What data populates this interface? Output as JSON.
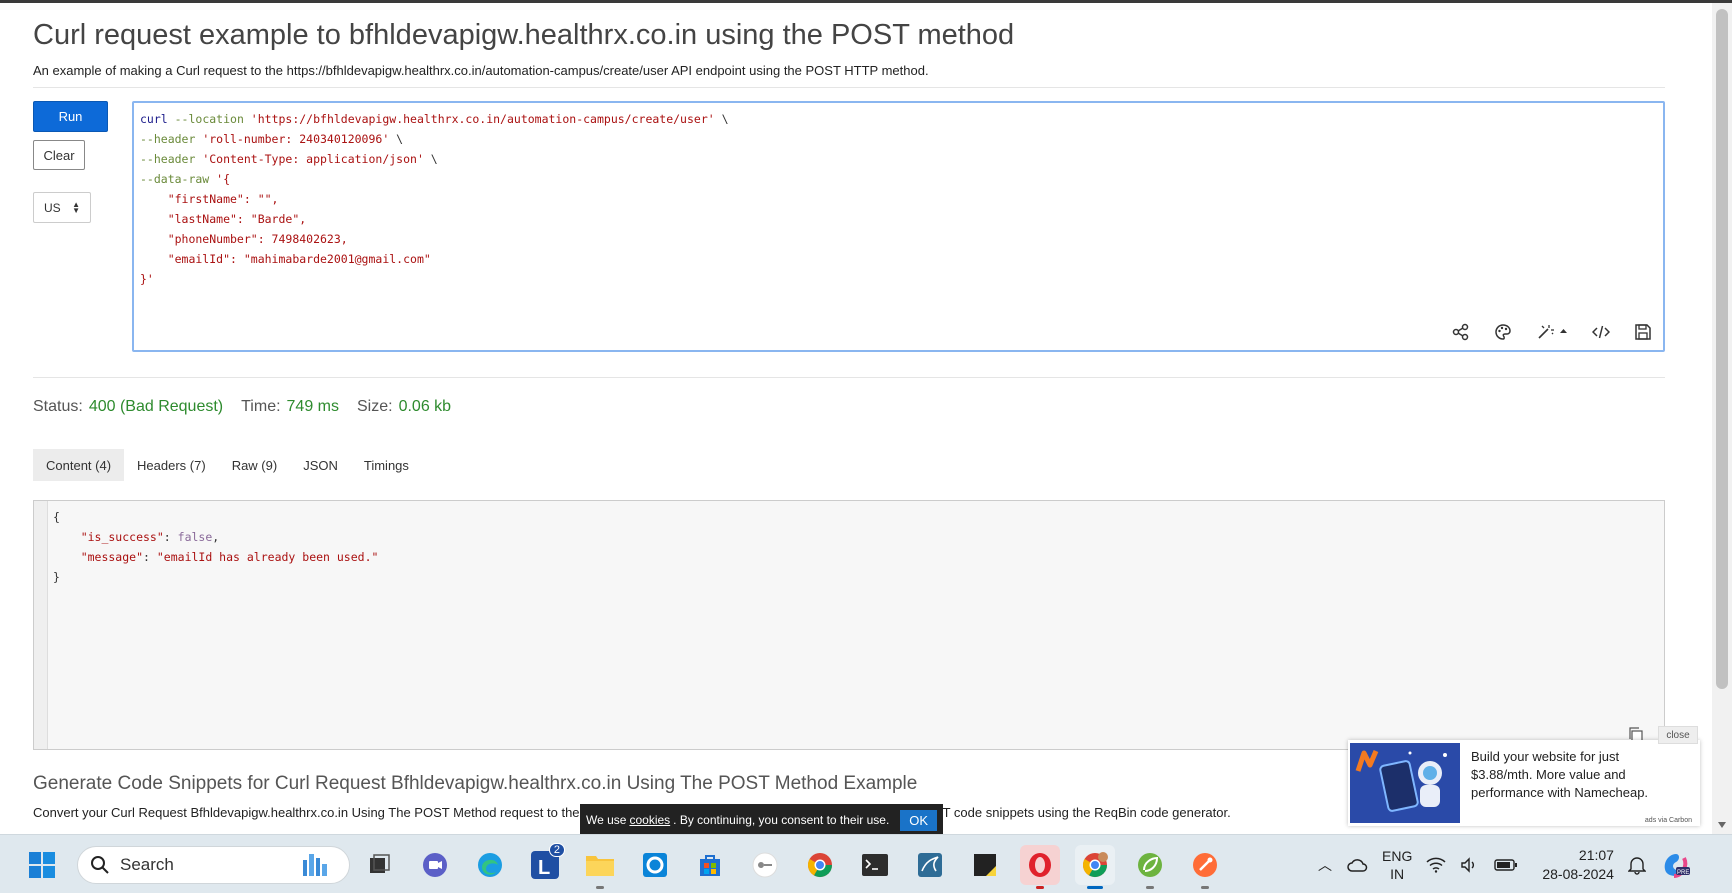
{
  "page": {
    "title": "Curl request example to bfhldevapigw.healthrx.co.in using the POST method",
    "subtitle": "An example of making a Curl request to the https://bfhldevapigw.healthrx.co.in/automation-campus/create/user API endpoint using the POST HTTP method."
  },
  "controls": {
    "run_label": "Run",
    "clear_label": "Clear",
    "region_value": "US"
  },
  "request_code": {
    "line1_cmd": "curl",
    "line1_flag": " --location ",
    "line1_str": "'https://bfhldevapigw.healthrx.co.in/automation-campus/create/user'",
    "line1_end": " \\",
    "line2_flag": "--header ",
    "line2_str": "'roll-number: 240340120096'",
    "line2_end": " \\",
    "line3_flag": "--header ",
    "line3_str": "'Content-Type: application/json'",
    "line3_end": " \\",
    "line4_flag": "--data-raw ",
    "line4_str": "'{",
    "line5": "    \"firstName\": \"\",",
    "line6": "    \"lastName\": \"Barde\",",
    "line7": "    \"phoneNumber\": 7498402623,",
    "line8": "    \"emailId\": \"mahimabarde2001@gmail.com\"",
    "line9": "}'"
  },
  "editor_tools": [
    "share-icon",
    "palette-icon",
    "magic-wand-icon",
    "code-icon",
    "save-icon"
  ],
  "status": {
    "status_label": "Status:",
    "status_value": "400 (Bad Request)",
    "time_label": "Time:",
    "time_value": "749 ms",
    "size_label": "Size:",
    "size_value": "0.06 kb"
  },
  "tabs": [
    {
      "label": "Content (4)"
    },
    {
      "label": "Headers (7)"
    },
    {
      "label": "Raw (9)"
    },
    {
      "label": "JSON"
    },
    {
      "label": "Timings"
    }
  ],
  "response": {
    "line1": "{",
    "line2_key": "    \"is_success\"",
    "line2_sep": ": ",
    "line2_val": "false",
    "line2_end": ",",
    "line3_key": "    \"message\"",
    "line3_sep": ": ",
    "line3_val": "\"emailId has already been used.\"",
    "line4": "}"
  },
  "section": {
    "heading": "Generate Code Snippets for Curl Request Bfhldevapigw.healthrx.co.in Using The POST Method Example",
    "para_start": "Convert your Curl Request Bfhldevapigw.healthrx.co.in Using The POST Method request to the",
    "para_end": "NET code snippets using the ReqBin code generator."
  },
  "cookie": {
    "text_before": "We use",
    "link": "cookies",
    "text_after": ". By continuing, you consent to their use.",
    "ok_label": "OK"
  },
  "ad": {
    "text": "Build your website for just $3.88/mth. More value and performance with Namecheap.",
    "via": "ads via Carbon",
    "close_label": "close"
  },
  "taskbar": {
    "search_placeholder": "Search",
    "lang_line1": "ENG",
    "lang_line2": "IN",
    "time": "21:07",
    "date": "28-08-2024",
    "badge_count": "2"
  },
  "colors": {
    "run_button": "#0d6ad8",
    "status_value": "#2e8b2e",
    "editor_border": "#8ab6f0"
  }
}
